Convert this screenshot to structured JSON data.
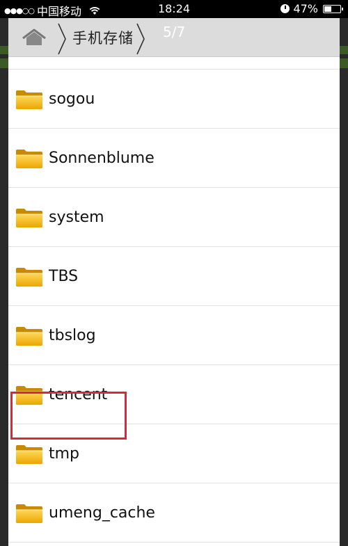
{
  "status_bar": {
    "signal": "●●●○○",
    "carrier": "中国移动",
    "time": "18:24",
    "battery_percent": "47%",
    "battery_level": 0.47
  },
  "breadcrumb": {
    "home_icon": "home-icon",
    "path_label": "手机存储",
    "page_indicator": "5/7"
  },
  "folders": [
    {
      "name": "sogou"
    },
    {
      "name": "Sonnenblume"
    },
    {
      "name": "system"
    },
    {
      "name": "TBS"
    },
    {
      "name": "tbslog"
    },
    {
      "name": "tencent",
      "highlighted": true
    },
    {
      "name": "tmp"
    },
    {
      "name": "umeng_cache"
    }
  ],
  "colors": {
    "highlight": "#d42a3a",
    "folder": "#f4b400"
  }
}
